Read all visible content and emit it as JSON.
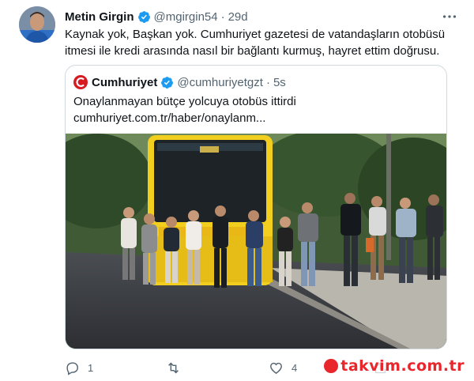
{
  "tweet": {
    "author_name": "Metin Girgin",
    "handle": "@mgirgin54",
    "separator": "·",
    "time": "29d",
    "text": "Kaynak yok, Başkan yok. Cumhuriyet gazetesi de vatandaşların otobüsü itmesi ile kredi arasında nasıl bir bağlantı kurmuş, hayret ettim doğrusu."
  },
  "quoted": {
    "author_name": "Cumhuriyet",
    "handle": "@cumhuriyetgzt",
    "separator": "·",
    "time": "5s",
    "text": "Onaylanmayan bütçe yolcuya otobüs ittirdi",
    "link": "cumhuriyet.com.tr/haber/onaylanm..."
  },
  "actions": {
    "reply_count": "1",
    "retweet_count": "",
    "like_count": "4"
  },
  "watermark": {
    "brand": "takvim",
    "tail": ".com.tr"
  },
  "colors": {
    "verified": "#1d9bf0",
    "text": "#0f1419",
    "muted": "#536471",
    "border": "#cfd9de",
    "cumhuriyet_red": "#d71920",
    "bus_yellow": "#f2cf1e"
  },
  "icons": [
    "verified-badge-icon",
    "more-icon",
    "cumhuriyet-logo-icon",
    "reply-icon",
    "retweet-icon",
    "like-icon",
    "share-icon"
  ]
}
